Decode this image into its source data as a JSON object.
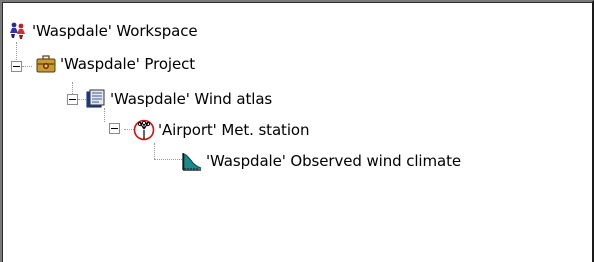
{
  "tree": {
    "nodes": [
      {
        "label": "'Waspdale' Workspace",
        "icon": "workspace-icon",
        "expanded": true
      },
      {
        "label": "'Waspdale' Project",
        "icon": "project-icon",
        "expanded": true
      },
      {
        "label": "'Waspdale' Wind atlas",
        "icon": "wind-atlas-icon",
        "expanded": true
      },
      {
        "label": "'Airport' Met. station",
        "icon": "met-station-icon",
        "expanded": true
      },
      {
        "label": "'Waspdale' Observed wind climate",
        "icon": "observed-wind-climate-icon",
        "expanded": false
      }
    ]
  },
  "colors": {
    "background": "#ffffff",
    "tree_line": "#9a9a9a",
    "met_station_ring": "#d01010"
  }
}
